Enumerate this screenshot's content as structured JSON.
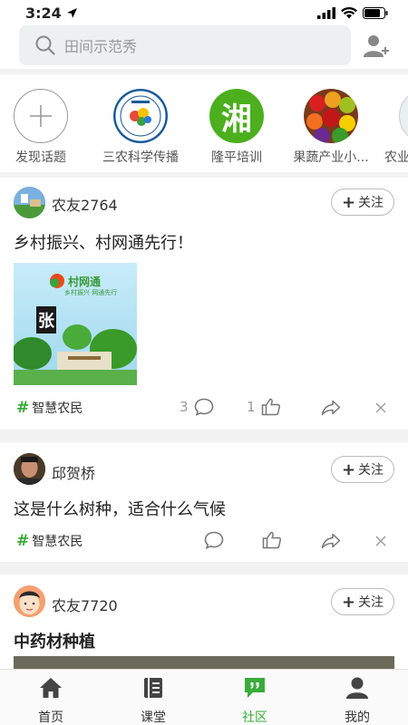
{
  "status_bar": {
    "time": "3:24"
  },
  "search": {
    "placeholder": "田间示范秀"
  },
  "topics": [
    {
      "label": "发现话题",
      "icon": "plus-icon"
    },
    {
      "label": "三农科学传播",
      "icon": "science-logo-icon"
    },
    {
      "label": "隆平培训",
      "icon": "xiang-logo-icon",
      "logo_text": "湘"
    },
    {
      "label": "果蔬产业小...",
      "icon": "fruits-icon"
    },
    {
      "label": "农业",
      "icon": "partial-icon"
    }
  ],
  "posts": [
    {
      "user": "农友2764",
      "follow_label": "关注",
      "text": "乡村振兴、村网通先行！",
      "image_brand": "村网通",
      "image_sub": "乡村振兴 网通先行",
      "image_calligraphy": "张",
      "tag": "智慧农民",
      "comments": "3",
      "likes": "1"
    },
    {
      "user": "邱贺桥",
      "follow_label": "关注",
      "text": "这是什么树种，适合什么气候",
      "tag": "智慧农民"
    },
    {
      "user": "农友7720",
      "follow_label": "关注",
      "text": "中药材种植"
    }
  ],
  "tabbar": [
    {
      "label": "首页",
      "icon": "home-icon"
    },
    {
      "label": "课堂",
      "icon": "book-icon"
    },
    {
      "label": "社区",
      "icon": "chat-icon",
      "active": true
    },
    {
      "label": "我的",
      "icon": "person-icon"
    }
  ],
  "colors": {
    "accent": "#3aab3a",
    "background": "#f2f2f2"
  }
}
